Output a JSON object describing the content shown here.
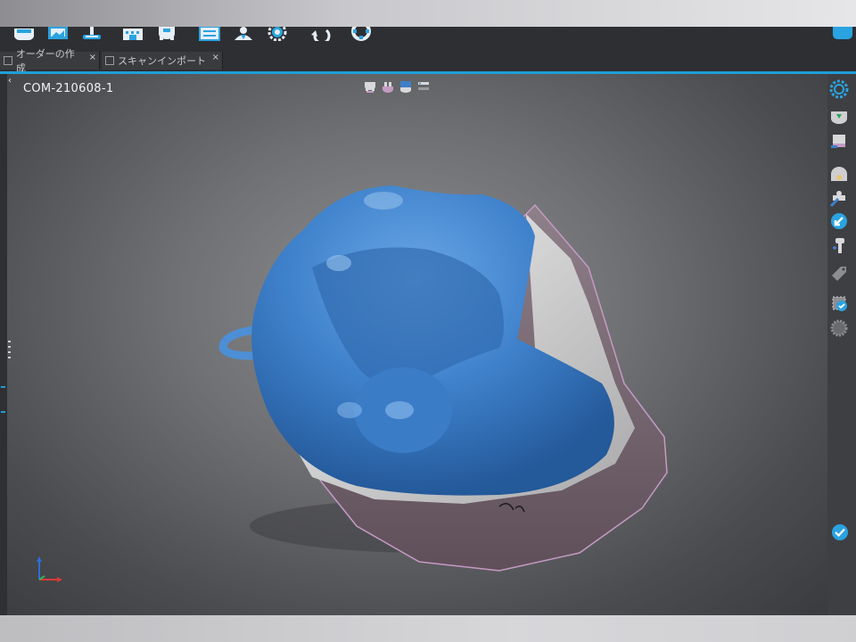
{
  "tabs": [
    {
      "label": "オーダーの作成",
      "close": "×"
    },
    {
      "label": "スキャンインポート",
      "close": "×"
    }
  ],
  "viewport": {
    "case_id": "COM-210608-1",
    "collapse_arrow": "‹"
  },
  "toolbar_icons": [
    "scanner-icon",
    "image-import-icon",
    "stand-icon",
    "building-icon",
    "model-icon",
    "checklist-icon",
    "operator-icon",
    "settings-gear-icon",
    "undo-icon",
    "lifebuoy-icon"
  ],
  "view_icons": [
    "upper-jaw-view-icon",
    "lower-jaw-view-icon",
    "occlusion-view-icon",
    "layers-view-icon"
  ],
  "side_tools": [
    "settings-gear-icon",
    "impression-tray-icon",
    "scan-model-icon",
    "jaw-icon",
    "crown-edit-icon",
    "arrow-zoom-icon",
    "implant-icon",
    "tag-icon",
    "chip-check-icon",
    "chip-icon"
  ],
  "colors": {
    "accent": "#1f9ed8",
    "tray_blue": "#3d7fc9",
    "stone_white": "#dcdcdc",
    "base_purple": "#7d6a75"
  }
}
